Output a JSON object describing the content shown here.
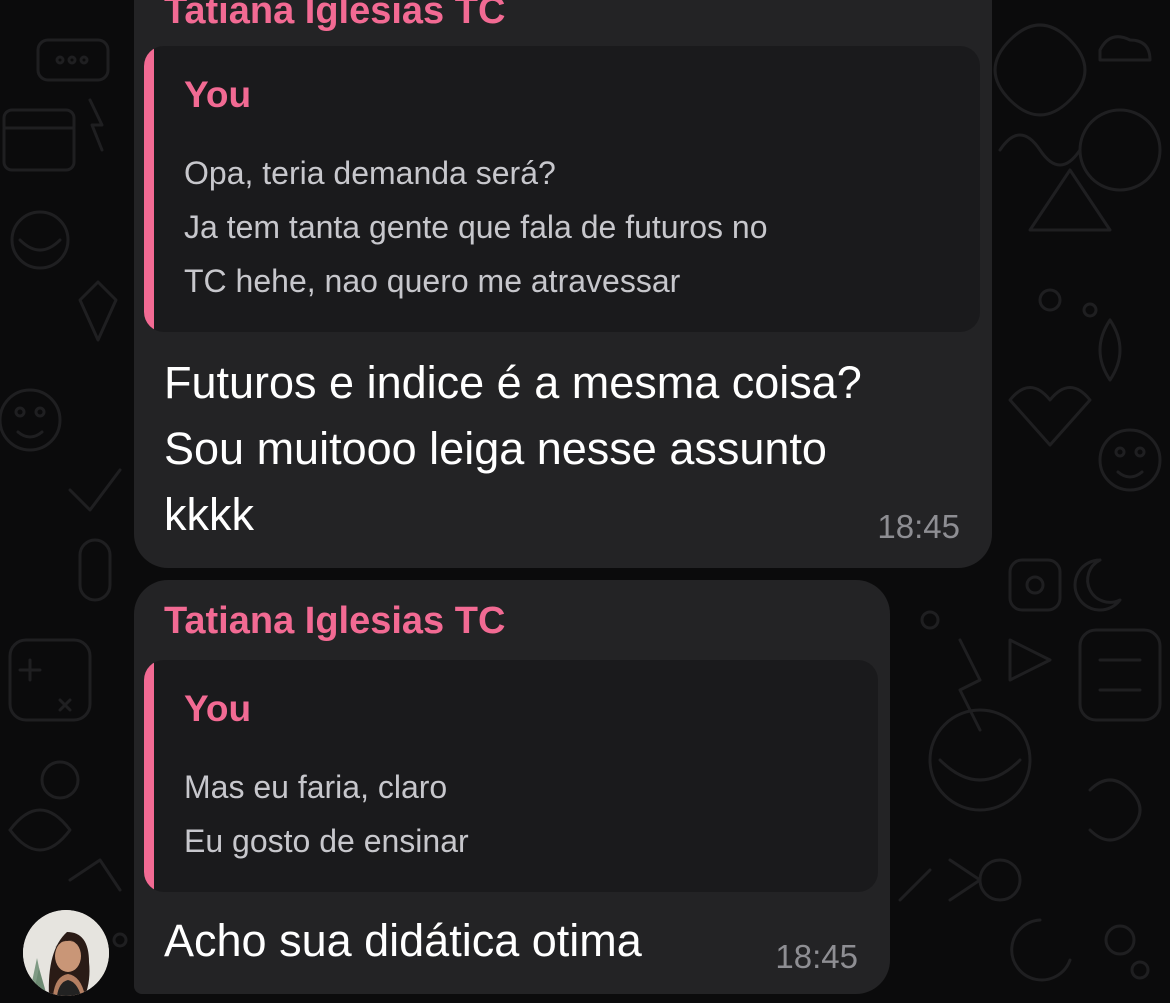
{
  "chat": {
    "messages": [
      {
        "sender": "Tatiana Iglesias TC",
        "reply_to": {
          "author": "You",
          "lines": [
            "Opa, teria demanda será?",
            "Ja tem tanta gente que fala de futuros no",
            "TC hehe, nao quero me atravessar"
          ]
        },
        "lines": [
          "Futuros e indice é a mesma coisa?",
          "Sou muitooo leiga nesse assunto",
          "kkkk"
        ],
        "time": "18:45"
      },
      {
        "sender": "Tatiana Iglesias TC",
        "reply_to": {
          "author": "You",
          "lines": [
            "Mas eu faria, claro",
            "Eu gosto de ensinar"
          ]
        },
        "lines": [
          "Acho sua didática otima"
        ],
        "time": "18:45"
      }
    ]
  },
  "colors": {
    "background": "#0b0b0c",
    "bubble": "#232325",
    "quote_background": "#1a1a1c",
    "accent_pink": "#f26a93",
    "message_text": "#ffffff",
    "quote_text": "#c7c7cc",
    "timestamp": "#8e8e93"
  },
  "icons": {
    "avatar": "contact-avatar"
  }
}
